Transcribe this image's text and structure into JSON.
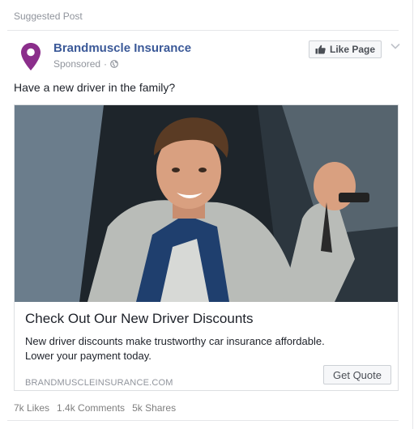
{
  "header": {
    "suggested_label": "Suggested Post"
  },
  "page": {
    "name": "Brandmuscle Insurance",
    "sponsored_label": "Sponsored",
    "separator": "·",
    "like_button_label": "Like Page",
    "brand_color": "#3b5998",
    "pin_color": "#8b2e8b"
  },
  "post": {
    "text": "Have a new driver in the family?"
  },
  "card": {
    "title": "Check Out Our New Driver Discounts",
    "description_line1": "New driver discounts make trustworthy car insurance affordable.",
    "description_line2": "Lower your payment today.",
    "domain": "BRANDMUSCLEINSURANCE.COM",
    "cta_label": "Get Quote"
  },
  "stats": {
    "likes": "7k Likes",
    "comments": "1.4k Comments",
    "shares": "5k Shares"
  },
  "icons": {
    "pin": "location-pin-icon",
    "globe": "globe-icon",
    "thumbs_up": "thumbs-up-icon",
    "chevron": "chevron-down-icon"
  }
}
